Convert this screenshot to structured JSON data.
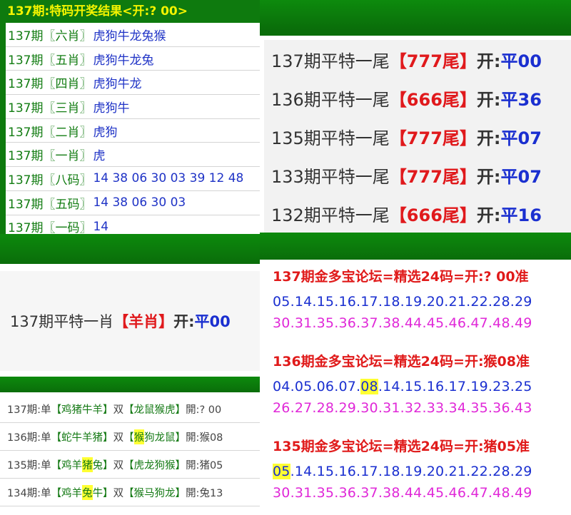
{
  "left_top": {
    "title": "137期:特码开奖结果<开:? 00>",
    "rows": [
      {
        "prefix": "137期〖六肖〗",
        "value": "虎狗牛龙兔猴"
      },
      {
        "prefix": "137期〖五肖〗",
        "value": "虎狗牛龙兔"
      },
      {
        "prefix": "137期〖四肖〗",
        "value": "虎狗牛龙"
      },
      {
        "prefix": "137期〖三肖〗",
        "value": "虎狗牛"
      },
      {
        "prefix": "137期〖二肖〗",
        "value": "虎狗"
      },
      {
        "prefix": "137期〖一肖〗",
        "value": "虎"
      },
      {
        "prefix": "137期〖八码〗",
        "value": "14 38 06 30 03 39 12 48"
      },
      {
        "prefix": "137期〖五码〗",
        "value": "14 38 06 30 03"
      },
      {
        "prefix": "137期〖一码〗",
        "value": "14"
      }
    ]
  },
  "right_top": {
    "rows": [
      {
        "issue": "137期平特一尾",
        "pick": "【777尾】",
        "open_label": "开:",
        "result": "平00"
      },
      {
        "issue": "136期平特一尾",
        "pick": "【666尾】",
        "open_label": "开:",
        "result": "平36"
      },
      {
        "issue": "135期平特一尾",
        "pick": "【777尾】",
        "open_label": "开:",
        "result": "平07"
      },
      {
        "issue": "133期平特一尾",
        "pick": "【777尾】",
        "open_label": "开:",
        "result": "平07"
      },
      {
        "issue": "132期平特一尾",
        "pick": "【666尾】",
        "open_label": "开:",
        "result": "平16"
      }
    ]
  },
  "left_middle": {
    "issue": "137期平特一肖",
    "pick": "【羊肖】",
    "open_label": "开:",
    "result": "平00"
  },
  "left_bottom": {
    "rows": [
      {
        "lead": "137期:单",
        "single": [
          "【鸡猪牛羊】"
        ],
        "mid": "双",
        "double": [
          "【龙鼠猴虎】"
        ],
        "open": "開:? 00"
      },
      {
        "lead": "136期:单",
        "single": [
          "【蛇牛羊猪】"
        ],
        "mid": "双",
        "double_pre": "【",
        "double_hl": "猴",
        "double_post": "狗龙鼠】",
        "open": "開:猴08"
      },
      {
        "lead": "135期:单",
        "single_pre": "【鸡羊",
        "single_hl": "猪",
        "single_post": "兔】",
        "mid": "双",
        "double": [
          "【虎龙狗猴】"
        ],
        "open": "開:猪05"
      },
      {
        "lead": "134期:单",
        "single_pre": "【鸡羊",
        "single_hl": "兔",
        "single_post": "牛】",
        "mid": "双",
        "double": [
          "【猴马狗龙】"
        ],
        "open": "開:兔13"
      }
    ]
  },
  "right_bottom": {
    "blocks": [
      {
        "head": "137期金多宝论坛=精选24码=开:? 00准",
        "line1_pre": "05.14.15.16.17.18.19.20.21.22.28.29",
        "line1_hl": "",
        "line1_post": "",
        "line2": "30.31.35.36.37.38.44.45.46.47.48.49"
      },
      {
        "head": "136期金多宝论坛=精选24码=开:猴08准",
        "line1_pre": "04.05.06.07.",
        "line1_hl": "08",
        "line1_post": ".14.15.16.17.19.23.25",
        "line2": "26.27.28.29.30.31.32.33.34.35.36.43"
      },
      {
        "head": "135期金多宝论坛=精选24码=开:猪05准",
        "line1_pre": "",
        "line1_hl": "05",
        "line1_post": ".14.15.16.17.18.19.20.21.22.28.29",
        "line2": "30.31.35.36.37.38.44.45.46.47.48.49"
      }
    ]
  },
  "colors": {
    "green": "#0c7e0c",
    "title_yellow": "#f4f400",
    "red": "#e0191c",
    "blue": "#1a2fd0",
    "pink": "#e028d8",
    "highlight": "#ffff33"
  }
}
